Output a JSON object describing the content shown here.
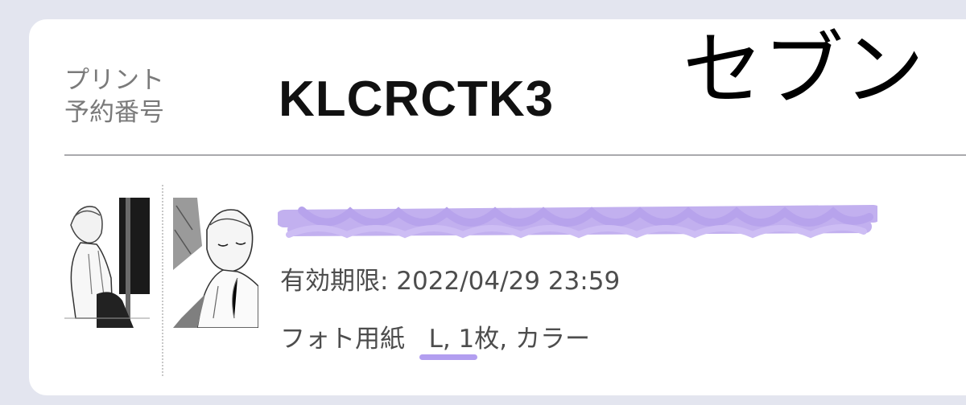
{
  "print": {
    "reservation_label_line1": "プリント",
    "reservation_label_line2": "予約番号",
    "reservation_number": "KLCRCTK3"
  },
  "annotation": {
    "store": "セブン"
  },
  "item": {
    "expiry": "有効期限: 2022/04/29 23:59",
    "paper_type": "フォト用紙",
    "size": "L,",
    "quantity_color": " 1枚, カラー"
  },
  "colors": {
    "background": "#e3e5ef",
    "card": "#ffffff",
    "redaction": "#c2b0ef",
    "size_highlight": "#b29ef0"
  }
}
